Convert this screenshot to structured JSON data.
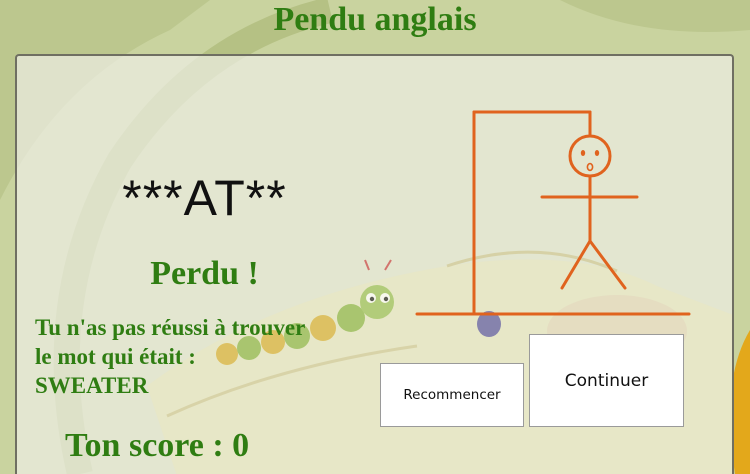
{
  "header": {
    "title": "Pendu anglais"
  },
  "game": {
    "masked_word": "***AT**",
    "result": "Perdu !",
    "message_line1": "Tu n'as pas réussi à trouver",
    "message_line2": "le mot qui était :",
    "answer": "SWEATER",
    "score_label": "Ton score : 0"
  },
  "buttons": {
    "restart_label": "Recommencer",
    "continue_label": "Continuer"
  },
  "colors": {
    "title_green": "#2f7d12",
    "hangman_orange": "#e0631e",
    "panel_border": "#6f6f62"
  }
}
